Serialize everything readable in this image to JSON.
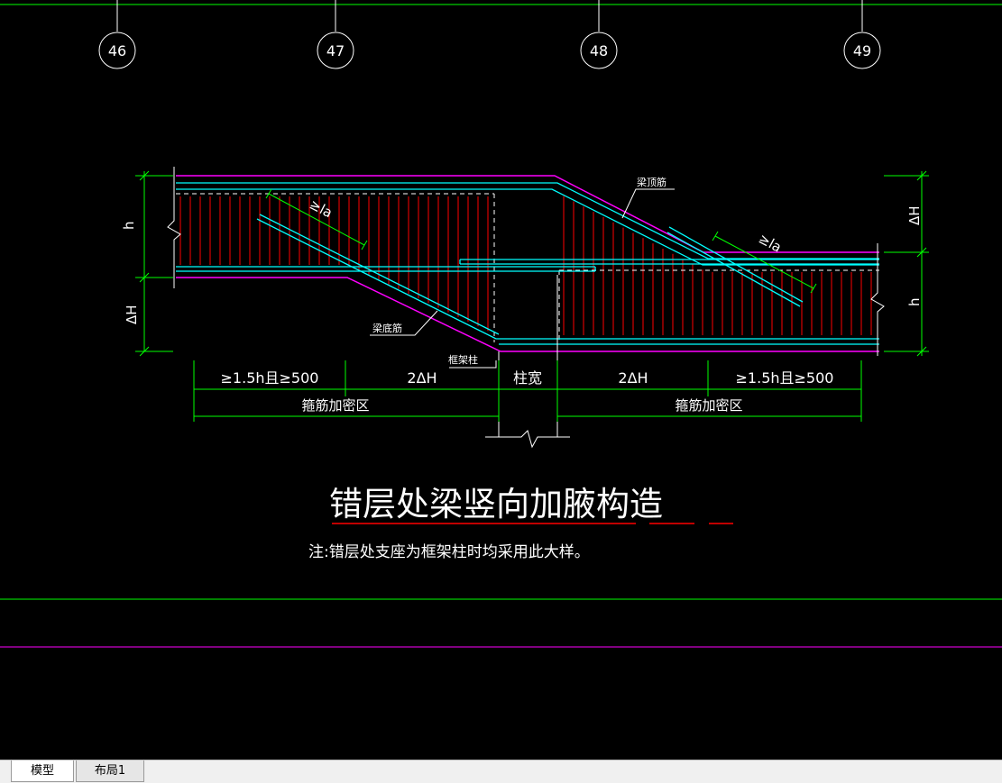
{
  "axes": [
    "46",
    "47",
    "48",
    "49"
  ],
  "labels": {
    "h_left": "h",
    "dh_left": "ΔH",
    "dh_right": "ΔH",
    "h_right": "h",
    "la_left": "≥la",
    "la_right": "≥la",
    "top_bar": "梁顶筋",
    "bottom_bar": "梁底筋",
    "frame_column": "框架柱"
  },
  "dimensions": {
    "d1": "≥1.5h且≥500",
    "d2": "2ΔH",
    "d3": "柱宽",
    "d4": "2ΔH",
    "d5": "≥1.5h且≥500",
    "zone_left": "箍筋加密区",
    "zone_right": "箍筋加密区"
  },
  "title": "错层处梁竖向加腋构造",
  "note": "注:错层处支座为框架柱时均采用此大样。",
  "tabs": {
    "model": "模型",
    "layout1": "布局1"
  },
  "colors": {
    "background": "#000000",
    "dimension": "#00ff00",
    "beam_outline": "#ff00ff",
    "rebar": "#00ffff",
    "stirrup": "#ff0000",
    "text": "#ffffff"
  }
}
